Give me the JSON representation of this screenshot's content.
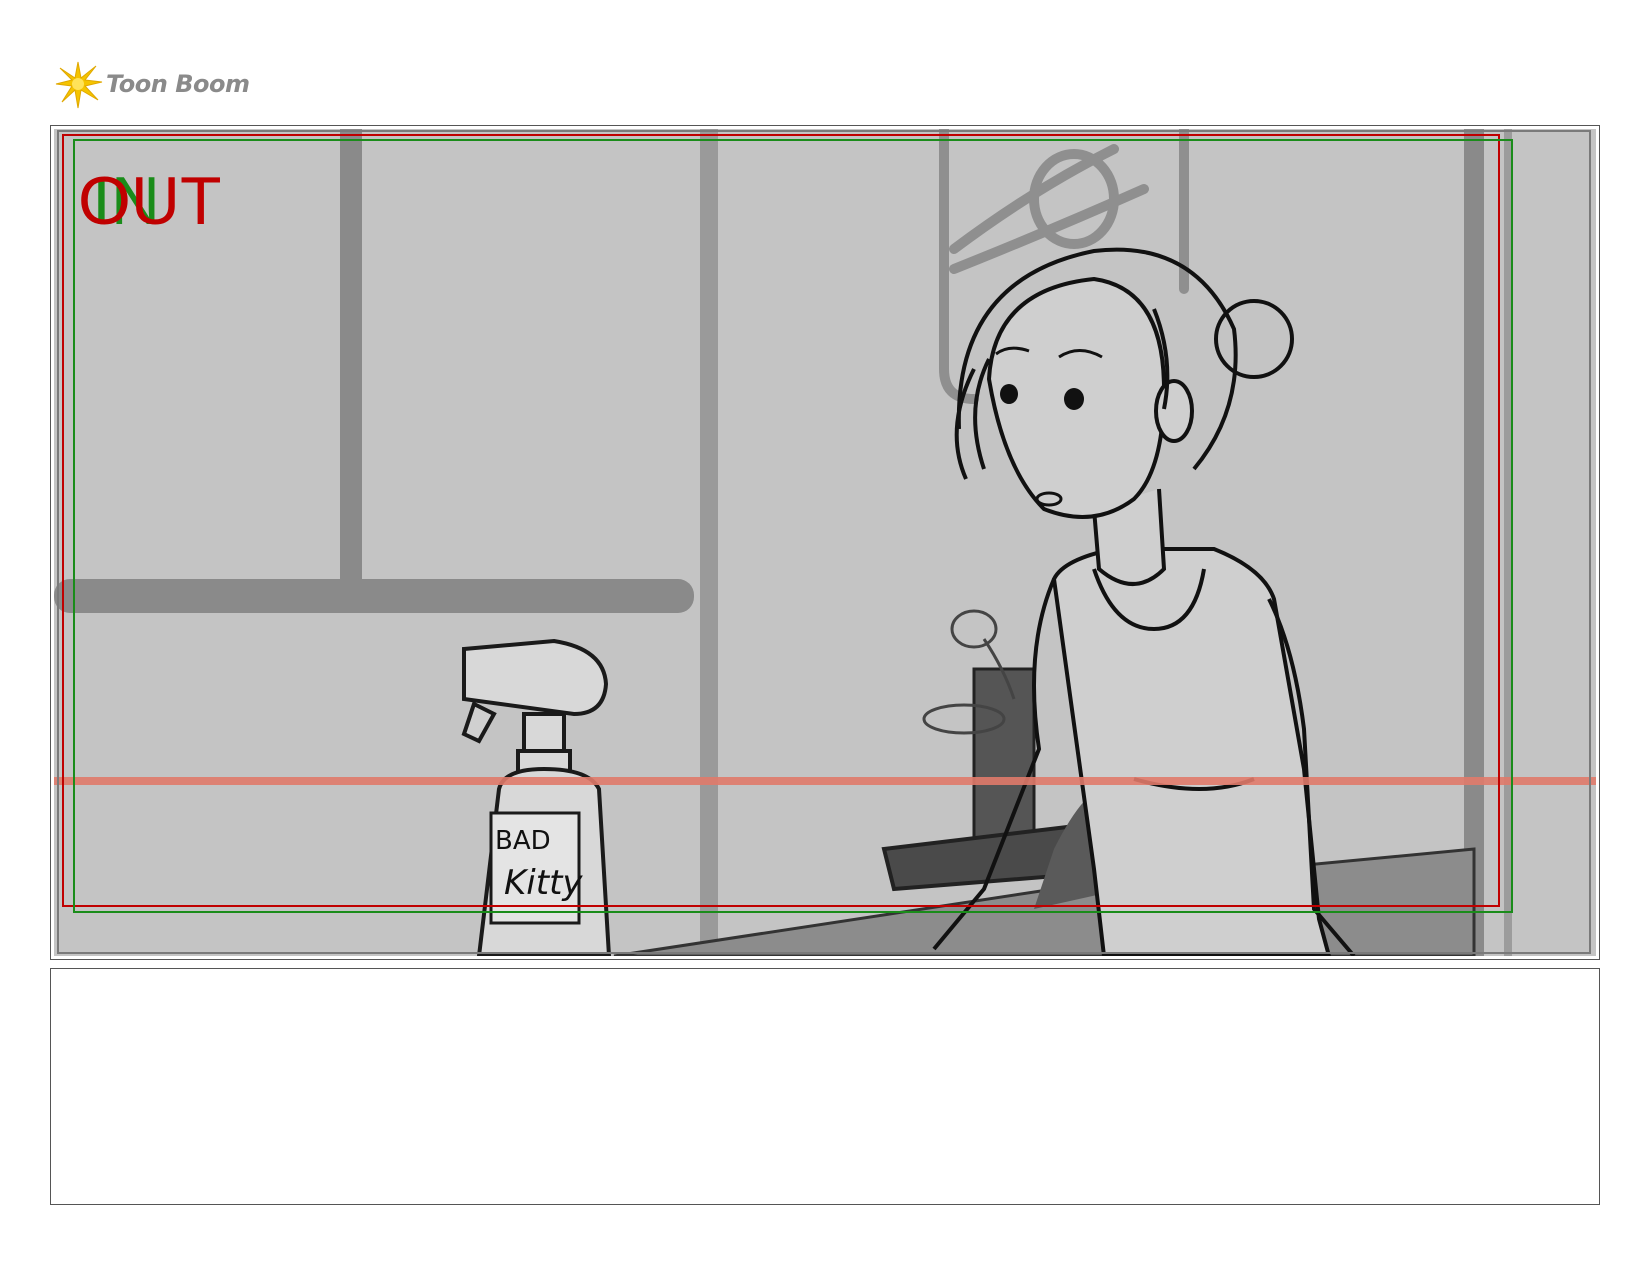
{
  "brand": {
    "logo_text": "Toon Boom",
    "logo_icon": "starburst-icon",
    "accent": "#f5c400"
  },
  "panel": {
    "overlay_in": "IN",
    "overlay_out": "OUT",
    "bottle_label_line1": "BAD",
    "bottle_label_line2": "Kitty",
    "colors": {
      "frame_red": "#c00000",
      "frame_green": "#1a8c1a",
      "guide_line": "#e07a6a",
      "background_gray": "#c4c4c4"
    }
  },
  "caption": {
    "text": ""
  }
}
